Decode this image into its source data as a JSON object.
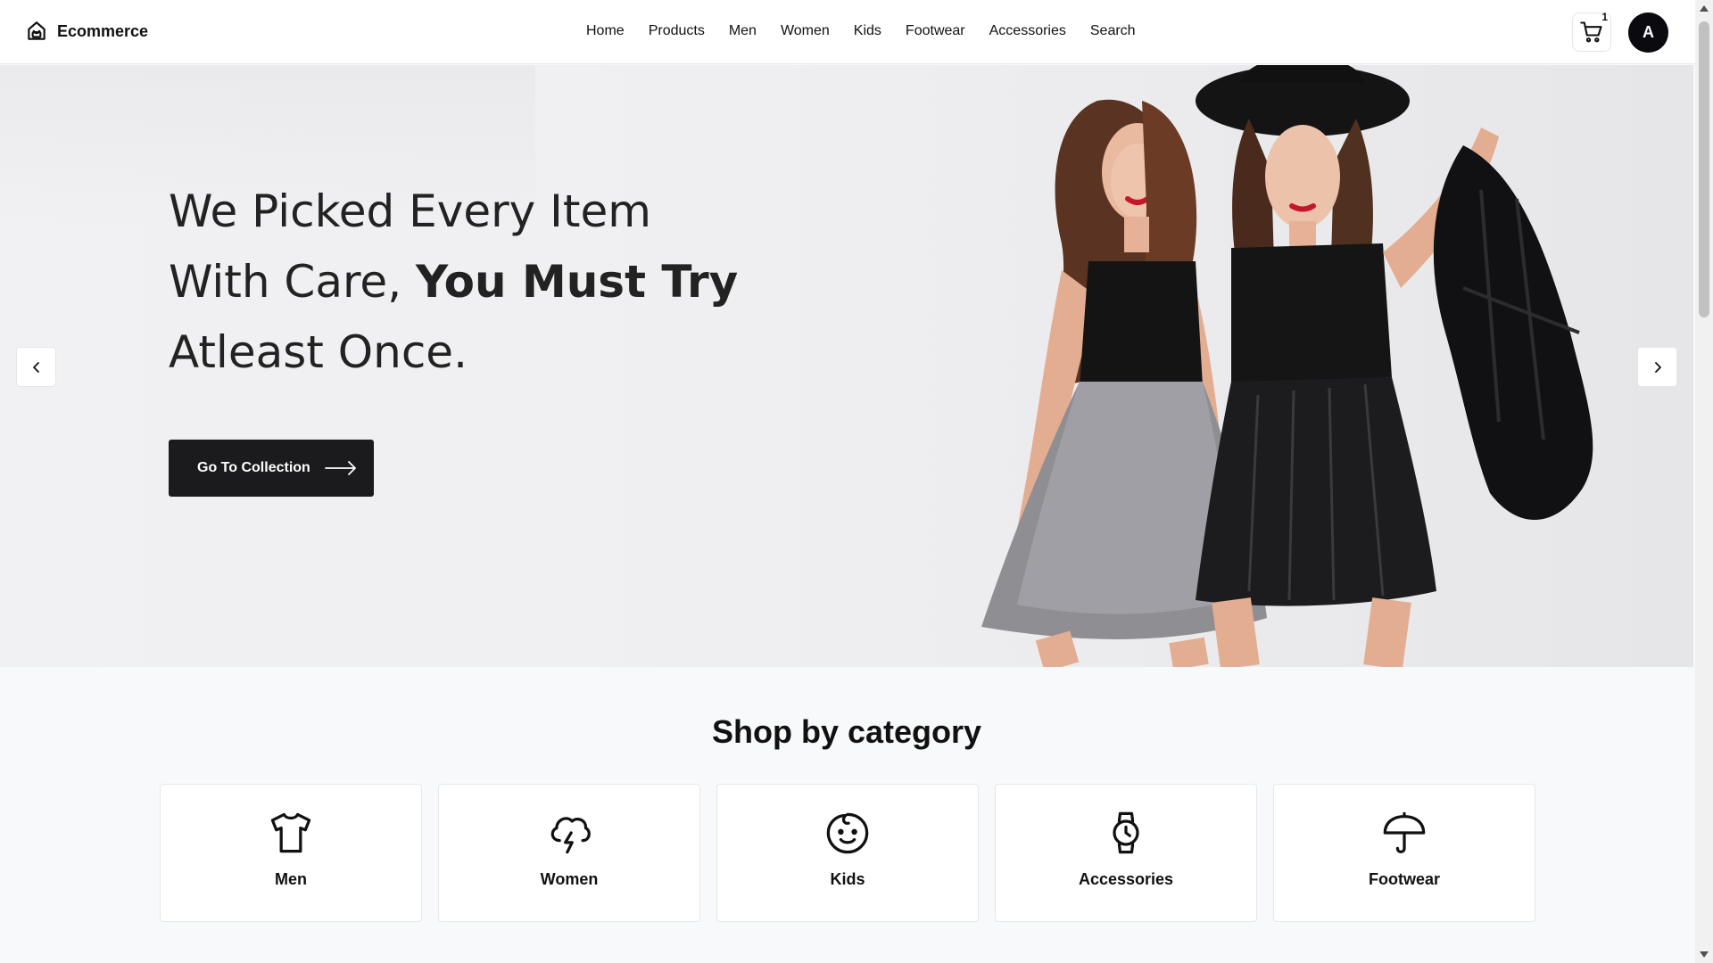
{
  "header": {
    "brand": "Ecommerce",
    "nav": [
      "Home",
      "Products",
      "Men",
      "Women",
      "Kids",
      "Footwear",
      "Accessories",
      "Search"
    ],
    "cart_count": "1",
    "avatar_initial": "A"
  },
  "hero": {
    "title_line1": "We Picked Every Item",
    "title_line2_regular": "With Care, ",
    "title_line2_bold": "You Must Try",
    "title_line3": "Atleast Once.",
    "cta_label": "Go To Collection"
  },
  "categories": {
    "title": "Shop by category",
    "items": [
      {
        "label": "Men",
        "icon": "tshirt-icon"
      },
      {
        "label": "Women",
        "icon": "storm-cloud-icon"
      },
      {
        "label": "Kids",
        "icon": "baby-face-icon"
      },
      {
        "label": "Accessories",
        "icon": "watch-icon"
      },
      {
        "label": "Footwear",
        "icon": "umbrella-icon"
      }
    ]
  },
  "colors": {
    "primary_dark": "#1b1b1d",
    "page_bg": "#f8f9fb",
    "card_bg": "#ffffff"
  }
}
